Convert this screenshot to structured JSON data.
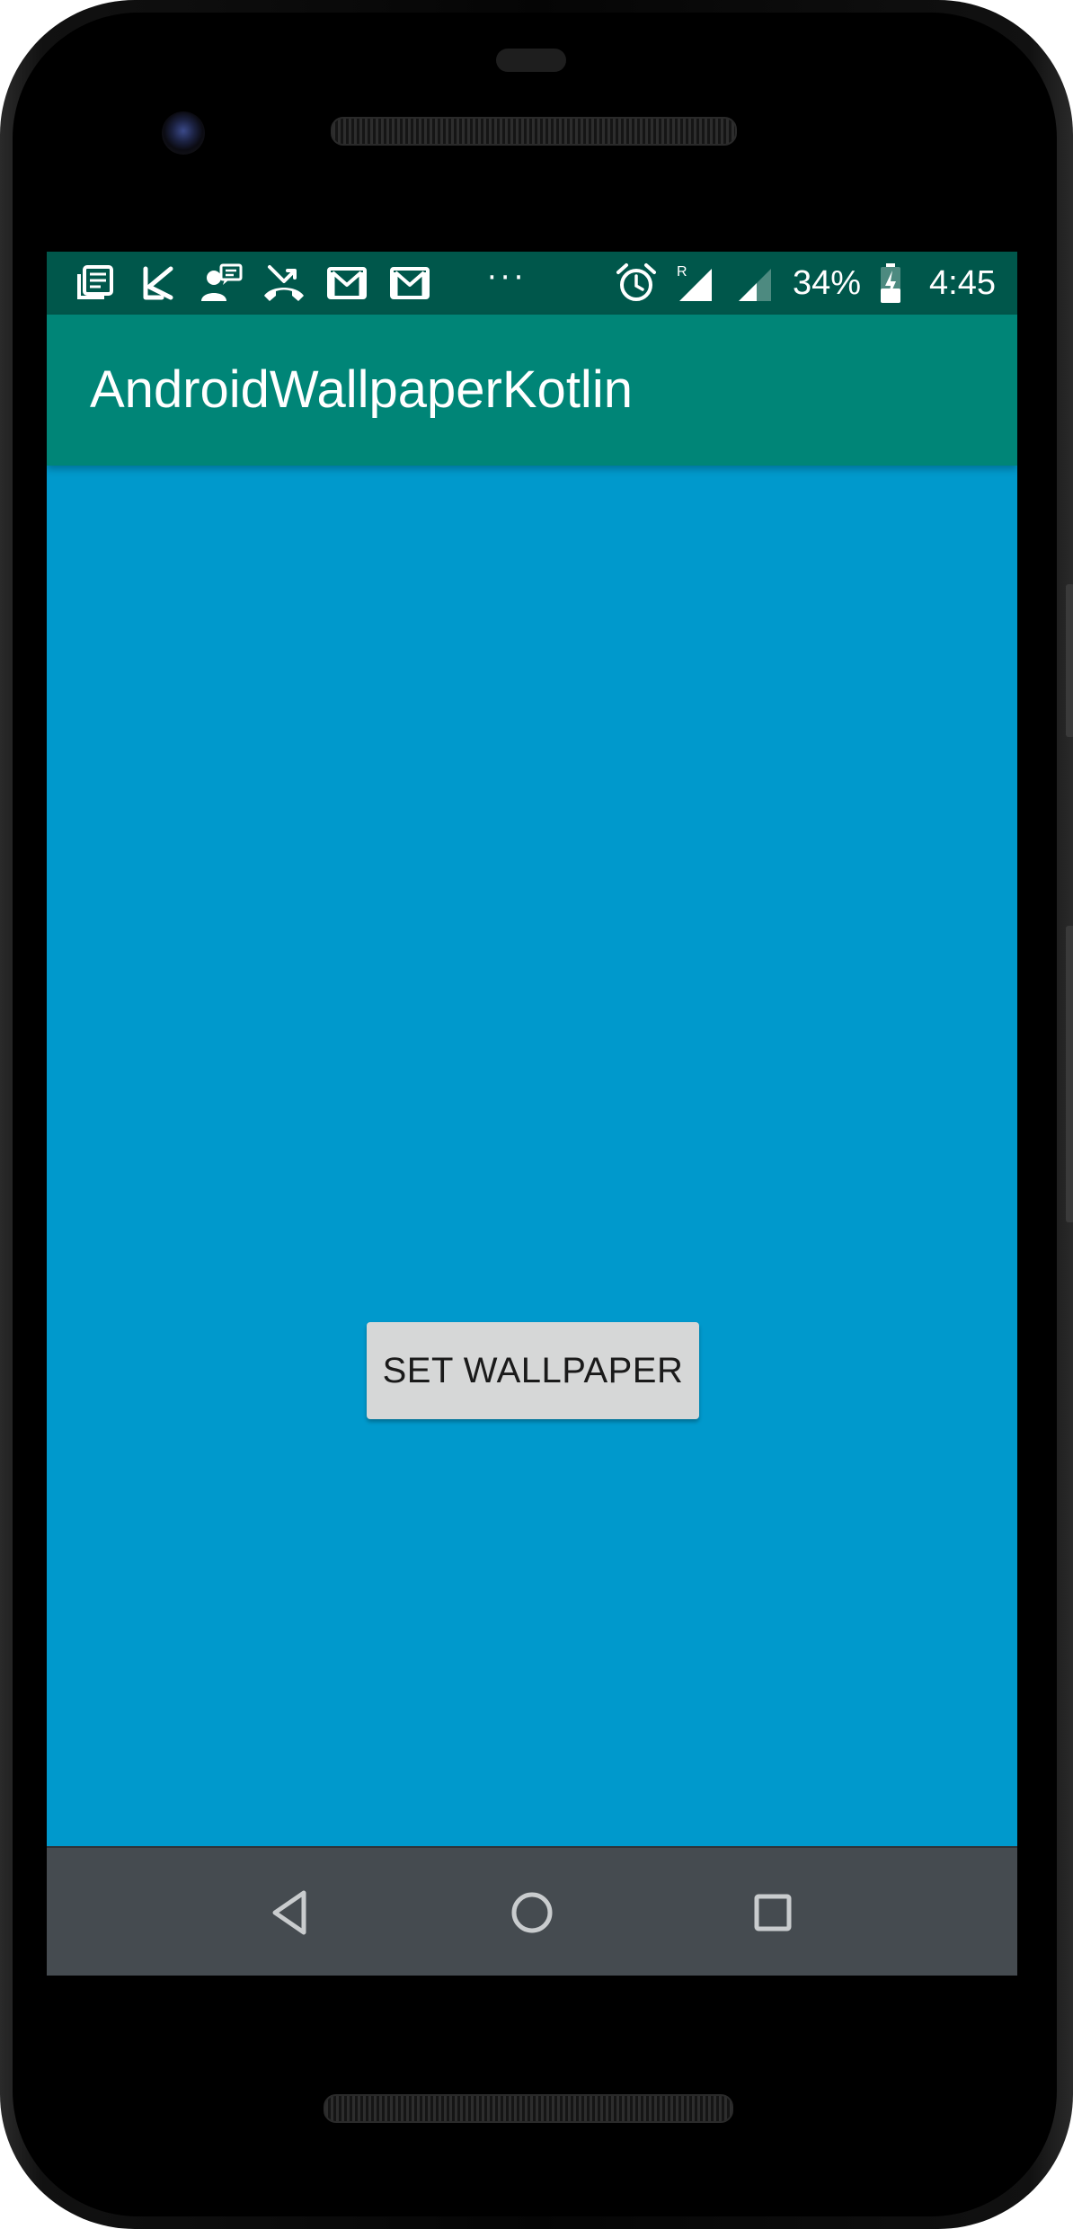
{
  "device": {
    "model_icons": [
      "earpiece",
      "camera",
      "speaker"
    ]
  },
  "status_bar": {
    "left_icons": [
      "news-icon",
      "k-app-icon",
      "contact-chat-icon",
      "missed-call-icon",
      "gmail-icon",
      "gmail-icon"
    ],
    "overflow": "···",
    "right_icons": [
      "alarm-icon",
      "signal-roaming-icon",
      "signal-icon",
      "battery-charging-icon"
    ],
    "roaming_label": "R",
    "battery": "34%",
    "time": "4:45",
    "background": "#00574b"
  },
  "app_bar": {
    "title": "AndroidWallpaperKotlin",
    "background": "#008577"
  },
  "content": {
    "background": "#0099cc",
    "button_label": "SET WALLPAPER"
  },
  "nav_bar": {
    "buttons": [
      "back-icon",
      "home-icon",
      "recents-icon"
    ],
    "background": "#454b50"
  }
}
